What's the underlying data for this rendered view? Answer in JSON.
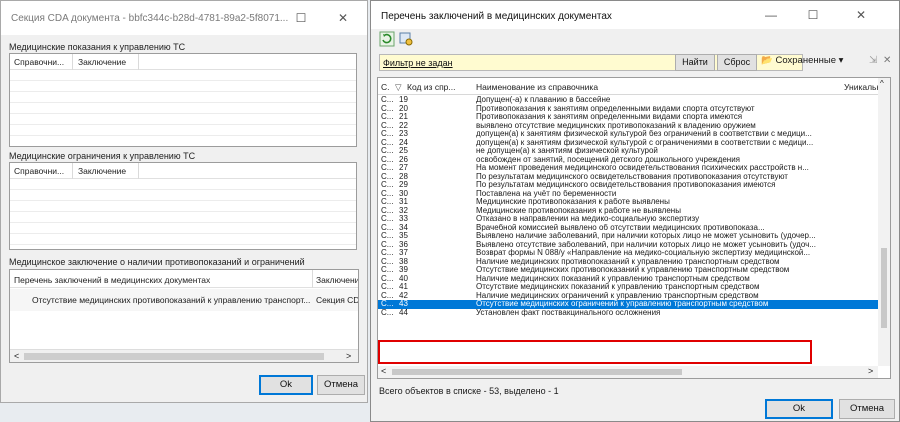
{
  "left_window": {
    "title": "Секция CDA документа - bbfc344c-b28d-4781-89a2-5f8071...",
    "sections": [
      {
        "label": "Медицинские показания к управлению ТС",
        "columns": [
          "Справочни...",
          "Заключение"
        ]
      },
      {
        "label": "Медицинские ограничения к управлению ТС",
        "columns": [
          "Справочни...",
          "Заключение"
        ]
      }
    ],
    "conclusion": {
      "label": "Медицинское заключение о наличии противопоказаний и ограничений",
      "col1": "Перечень заключений в медицинских документах",
      "col2": "Заключени",
      "row_col1": "Отсутствие медицинских противопоказаний к управлению транспорт...",
      "row_col2": "Секция CD"
    },
    "ok_label": "Ok",
    "cancel_label": "Отмена",
    "close_glyph": "✕",
    "maximize_glyph": "☐"
  },
  "right_window": {
    "title": "Перечень заключений в медицинских документах",
    "filter_text": "Фильтр не задан",
    "find_label": "Найти",
    "reset_label": "Сброс",
    "saved_label": "Сохраненные",
    "columns": {
      "c1": "С.",
      "c2": "Код из спр...",
      "c3": "Наименование из справочника",
      "c4": "Уникальн"
    },
    "rows": [
      {
        "c1": "С...",
        "code": "19",
        "name": "Допущен(-а) к плаванию в бассейне"
      },
      {
        "c1": "С...",
        "code": "20",
        "name": "Противопоказания к занятиям определенными видами спорта отсутствуют"
      },
      {
        "c1": "С...",
        "code": "21",
        "name": "Противопоказания к занятиям определенными видами спорта имеются"
      },
      {
        "c1": "С...",
        "code": "22",
        "name": "выявлено отсутствие медицинских противопоказаний к владению оружием"
      },
      {
        "c1": "С...",
        "code": "23",
        "name": "допущен(а) к занятиям физической культурой без ограничений в соответствии с медици..."
      },
      {
        "c1": "С...",
        "code": "24",
        "name": "допущен(а) к занятиям физической культурой с ограничениями в соответствии с медици..."
      },
      {
        "c1": "С...",
        "code": "25",
        "name": "не допущен(а) к занятиям физической культурой"
      },
      {
        "c1": "С...",
        "code": "26",
        "name": "освобожден от занятий, посещений детского дошкольного учреждения"
      },
      {
        "c1": "С...",
        "code": "27",
        "name": "На момент проведения медицинского освидетельствования психических расстройств н..."
      },
      {
        "c1": "С...",
        "code": "28",
        "name": "По результатам медицинского освидетельствования противопоказания отсутствуют"
      },
      {
        "c1": "С...",
        "code": "29",
        "name": "По результатам медицинского освидетельствования противопоказания имеются"
      },
      {
        "c1": "С...",
        "code": "30",
        "name": "Поставлена на учёт по беременности"
      },
      {
        "c1": "С...",
        "code": "31",
        "name": "Медицинские противопоказания к работе выявлены"
      },
      {
        "c1": "С...",
        "code": "32",
        "name": "Медицинские противопоказания к работе не выявлены"
      },
      {
        "c1": "С...",
        "code": "33",
        "name": "Отказано в направлении на медико-социальную экспертизу"
      },
      {
        "c1": "С...",
        "code": "34",
        "name": "Врачебной комиссией выявлено об отсутствии медицинских противопоказа..."
      },
      {
        "c1": "С...",
        "code": "35",
        "name": "Выявлено наличие заболеваний, при наличии которых лицо не может усыновить (удочер..."
      },
      {
        "c1": "С...",
        "code": "36",
        "name": "Выявлено отсутствие заболеваний, при наличии которых лицо не может усыновить (удоч..."
      },
      {
        "c1": "С...",
        "code": "37",
        "name": "Возврат формы N 088/у «Направление на медико-социальную экспертизу медицинской..."
      },
      {
        "c1": "С...",
        "code": "38",
        "name": "Наличие медицинских противопоказаний к управлению транспортным средством"
      },
      {
        "c1": "С...",
        "code": "39",
        "name": "Отсутствие медицинских противопоказаний к управлению транспортным средством"
      },
      {
        "c1": "С...",
        "code": "40",
        "name": "Наличие медицинских показаний к управлению транспортным средством"
      },
      {
        "c1": "С...",
        "code": "41",
        "name": "Отсутствие медицинских показаний к управлению транспортным средством"
      },
      {
        "c1": "С...",
        "code": "42",
        "name": "Наличие медицинских ограничений к управлению транспортным средством"
      },
      {
        "c1": "С...",
        "code": "43",
        "name": "Отсутствие медицинских ограничений к управлению транспортным средством"
      },
      {
        "c1": "С...",
        "code": "44",
        "name": "Установлен факт поствакцинального осложнения"
      }
    ],
    "status_text": "Всего объектов в списке - 53, выделено - 1",
    "ok_label": "Ok",
    "cancel_label": "Отмена",
    "minimize_glyph": "—",
    "maximize_glyph": "☐",
    "close_glyph": "✕"
  },
  "colors": {
    "selection": "#0078d7",
    "highlight_box": "#e00000",
    "filter_bg": "#fffbd0"
  }
}
